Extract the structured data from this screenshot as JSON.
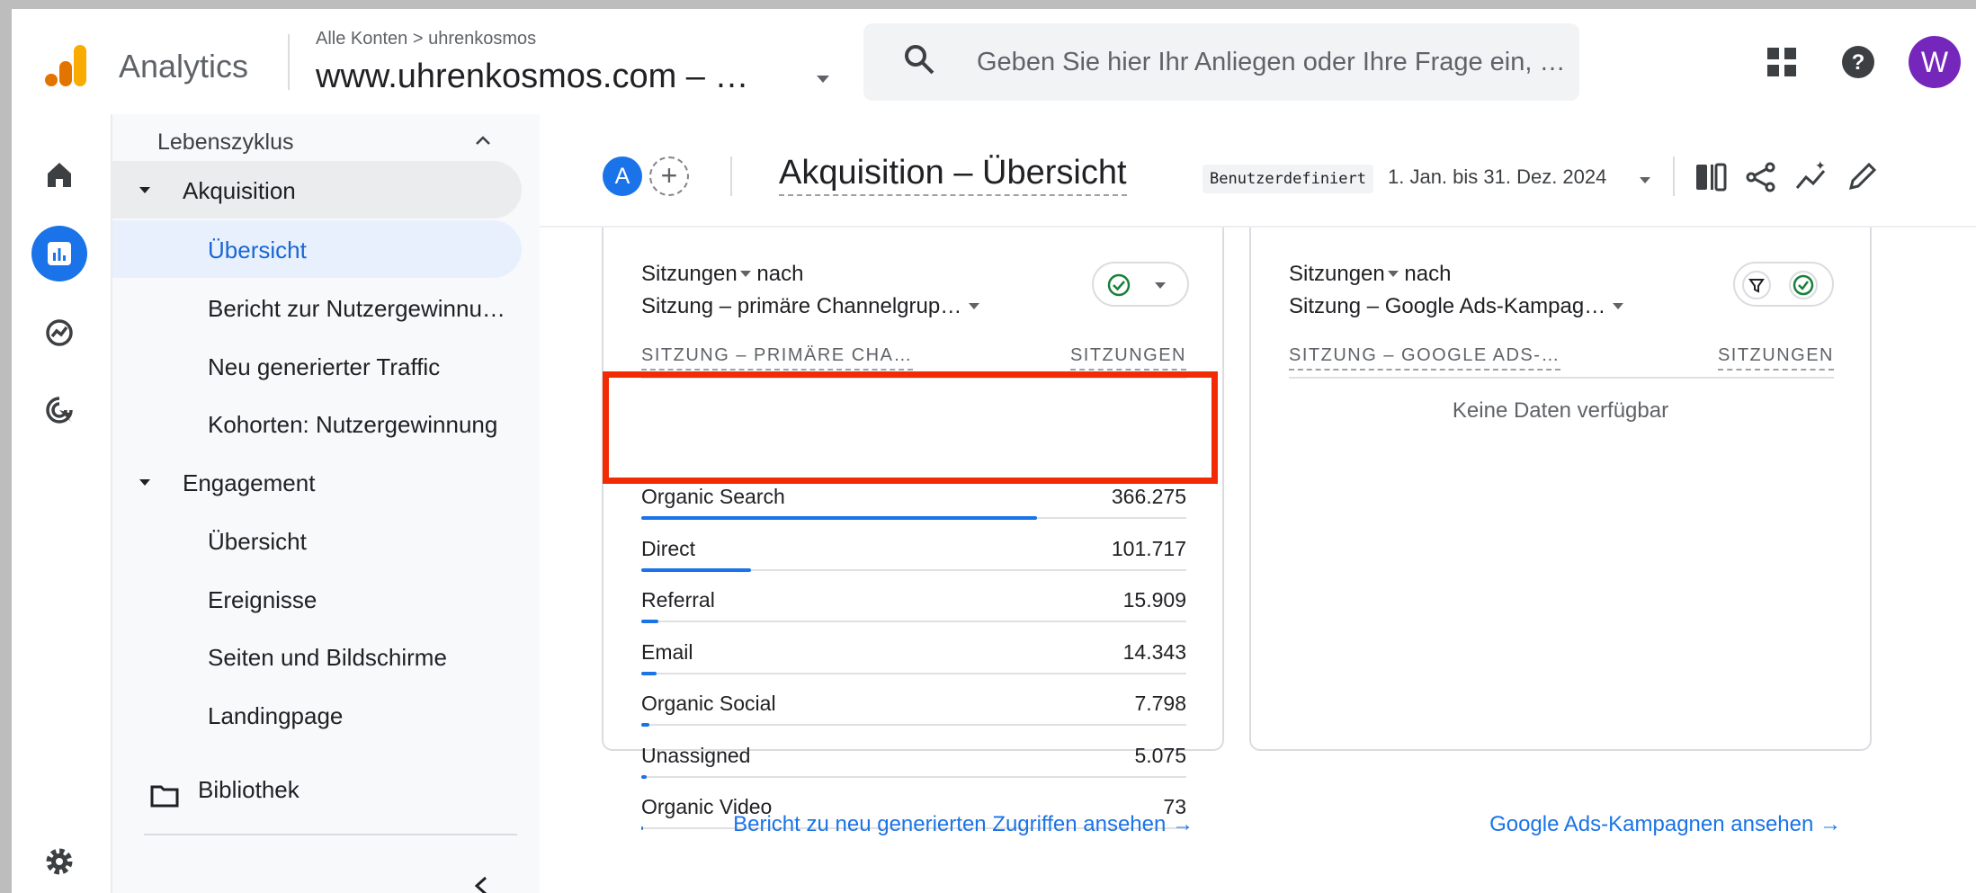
{
  "header": {
    "app_name": "Analytics",
    "breadcrumb": "Alle Konten > uhrenkosmos",
    "property": "www.uhrenkosmos.com – …",
    "search_placeholder": "Geben Sie hier Ihr Anliegen oder Ihre Frage ein, …",
    "avatar_letter": "W",
    "avatar_color": "#7627bb"
  },
  "rail": {
    "icons": [
      "home-icon",
      "reports-icon",
      "explore-icon",
      "advertising-icon",
      "settings-icon"
    ]
  },
  "nav": {
    "section": "Lebenszyklus",
    "groups": [
      {
        "label": "Akquisition",
        "items": [
          "Übersicht",
          "Bericht zur Nutzergewinnu…",
          "Neu generierter Traffic",
          "Kohorten: Nutzergewinnung"
        ]
      },
      {
        "label": "Engagement",
        "items": [
          "Übersicht",
          "Ereignisse",
          "Seiten und Bildschirme",
          "Landingpage"
        ]
      }
    ],
    "library": "Bibliothek",
    "active_item": "Übersicht"
  },
  "toolbar": {
    "compare_badge": "A",
    "add_compare": "+",
    "title": "Akquisition – Übersicht",
    "date_chip": "Benutzerdefiniert",
    "date_range": "1. Jan. bis 31. Dez. 2024"
  },
  "card_left": {
    "metric": "Sitzungen",
    "by": "nach",
    "dimension": "Sitzung – primäre Channelgrup…",
    "col_dimension": "SITZUNG – PRIMÄRE CHA…",
    "col_metric": "SITZUNGEN",
    "rows": [
      {
        "label": "Organic Search",
        "value": "366.275",
        "share": 1.0
      },
      {
        "label": "Direct",
        "value": "101.717",
        "share": 0.2777
      },
      {
        "label": "Referral",
        "value": "15.909",
        "share": 0.0434
      },
      {
        "label": "Email",
        "value": "14.343",
        "share": 0.0392
      },
      {
        "label": "Organic Social",
        "value": "7.798",
        "share": 0.0213
      },
      {
        "label": "Unassigned",
        "value": "5.075",
        "share": 0.0139
      },
      {
        "label": "Organic Video",
        "value": "73",
        "share": 0.0002
      }
    ],
    "link": "Bericht zu neu generierten Zugriffen ansehen →"
  },
  "card_right": {
    "metric": "Sitzungen",
    "by": "nach",
    "dimension": "Sitzung – Google Ads-Kampag…",
    "col_dimension": "SITZUNG – GOOGLE ADS-…",
    "col_metric": "SITZUNGEN",
    "empty": "Keine Daten verfügbar",
    "link": "Google Ads-Kampagnen ansehen →"
  },
  "colors": {
    "accent": "#1a73e8",
    "highlight": "#f22b05",
    "check": "#188038"
  }
}
